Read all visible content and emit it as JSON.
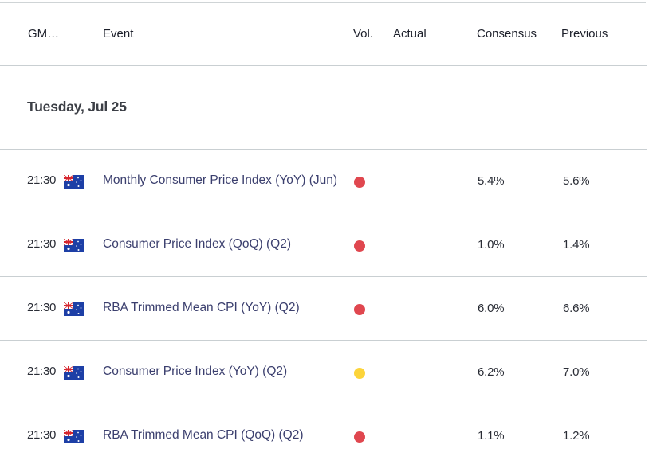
{
  "header": {
    "time_col": "GM…",
    "event_col": "Event",
    "vol_col": "Vol.",
    "actual_col": "Actual",
    "consensus_col": "Consensus",
    "previous_col": "Previous"
  },
  "date_group": "Tuesday, Jul 25",
  "colors": {
    "high_impact": "#e0474f",
    "medium_impact": "#fcd43a",
    "event_text": "#3b3f6e",
    "divider": "#c9cfd2"
  },
  "events": [
    {
      "time": "21:30",
      "country": "Australia",
      "flag_icon": "australia-flag-icon",
      "event": "Monthly Consumer Price Index (YoY) (Jun)",
      "volatility": "high",
      "actual": "",
      "consensus": "5.4%",
      "previous": "5.6%"
    },
    {
      "time": "21:30",
      "country": "Australia",
      "flag_icon": "australia-flag-icon",
      "event": "Consumer Price Index (QoQ) (Q2)",
      "volatility": "high",
      "actual": "",
      "consensus": "1.0%",
      "previous": "1.4%"
    },
    {
      "time": "21:30",
      "country": "Australia",
      "flag_icon": "australia-flag-icon",
      "event": "RBA Trimmed Mean CPI (YoY) (Q2)",
      "volatility": "high",
      "actual": "",
      "consensus": "6.0%",
      "previous": "6.6%"
    },
    {
      "time": "21:30",
      "country": "Australia",
      "flag_icon": "australia-flag-icon",
      "event": "Consumer Price Index (YoY) (Q2)",
      "volatility": "medium",
      "actual": "",
      "consensus": "6.2%",
      "previous": "7.0%"
    },
    {
      "time": "21:30",
      "country": "Australia",
      "flag_icon": "australia-flag-icon",
      "event": "RBA Trimmed Mean CPI (QoQ) (Q2)",
      "volatility": "high",
      "actual": "",
      "consensus": "1.1%",
      "previous": "1.2%"
    }
  ]
}
